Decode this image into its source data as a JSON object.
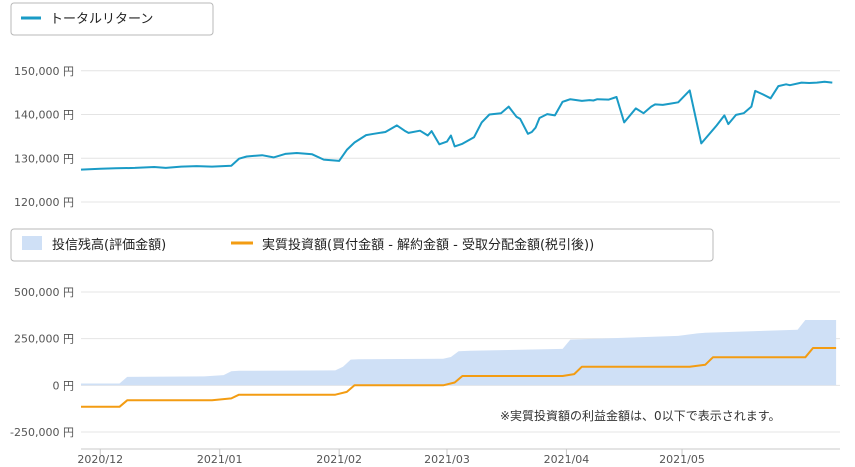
{
  "chart_data": [
    {
      "type": "line",
      "legend": [
        {
          "label": "トータルリターン",
          "color": "#1a9bc6"
        }
      ],
      "yticks": [
        {
          "value": 150000,
          "label": "150,000 円"
        },
        {
          "value": 140000,
          "label": "140,000 円"
        },
        {
          "value": 130000,
          "label": "130,000 円"
        },
        {
          "value": 120000,
          "label": "120,000 円"
        }
      ],
      "ylim": [
        120000,
        152000
      ],
      "series": [
        {
          "name": "トータルリターン",
          "color": "#1a9bc6",
          "x": [
            "2020-11-26",
            "2020-12-01",
            "2020-12-05",
            "2020-12-10",
            "2020-12-15",
            "2020-12-18",
            "2020-12-22",
            "2020-12-26",
            "2020-12-30",
            "2021-01-04",
            "2021-01-06",
            "2021-01-08",
            "2021-01-12",
            "2021-01-15",
            "2021-01-18",
            "2021-01-21",
            "2021-01-25",
            "2021-01-28",
            "2021-02-01",
            "2021-02-03",
            "2021-02-05",
            "2021-02-08",
            "2021-02-10",
            "2021-02-13",
            "2021-02-16",
            "2021-02-18",
            "2021-02-19",
            "2021-02-22",
            "2021-02-24",
            "2021-02-25",
            "2021-02-27",
            "2021-03-01",
            "2021-03-02",
            "2021-03-03",
            "2021-03-05",
            "2021-03-08",
            "2021-03-10",
            "2021-03-12",
            "2021-03-15",
            "2021-03-17",
            "2021-03-19",
            "2021-03-20",
            "2021-03-22",
            "2021-03-23",
            "2021-03-24",
            "2021-03-25",
            "2021-03-27",
            "2021-03-29",
            "2021-03-31",
            "2021-04-01",
            "2021-04-02",
            "2021-04-05",
            "2021-04-07",
            "2021-04-08",
            "2021-04-09",
            "2021-04-12",
            "2021-04-14",
            "2021-04-16",
            "2021-04-19",
            "2021-04-21",
            "2021-04-23",
            "2021-04-24",
            "2021-04-26",
            "2021-04-28",
            "2021-04-30",
            "2021-05-03",
            "2021-05-06",
            "2021-05-10",
            "2021-05-12",
            "2021-05-13",
            "2021-05-15",
            "2021-05-17",
            "2021-05-19",
            "2021-05-20",
            "2021-05-22",
            "2021-05-24",
            "2021-05-26",
            "2021-05-28",
            "2021-05-29",
            "2021-06-01",
            "2021-06-03",
            "2021-06-05",
            "2021-06-07",
            "2021-06-09"
          ],
          "y": [
            127400,
            127600,
            127700,
            127800,
            128000,
            127800,
            128100,
            128200,
            128100,
            128300,
            129900,
            130400,
            130700,
            130200,
            131000,
            131200,
            130900,
            129700,
            129400,
            131900,
            133600,
            135300,
            135600,
            136000,
            137500,
            136300,
            135800,
            136300,
            135200,
            136200,
            133200,
            133800,
            135200,
            132700,
            133300,
            134800,
            138200,
            140000,
            140300,
            141800,
            139500,
            139000,
            135600,
            136000,
            137000,
            139200,
            140100,
            139800,
            142900,
            143200,
            143500,
            143100,
            143300,
            143200,
            143500,
            143400,
            144000,
            138200,
            141400,
            140300,
            141800,
            142300,
            142200,
            142500,
            142800,
            145500,
            133400,
            137500,
            139800,
            137800,
            139900,
            140300,
            141800,
            145400,
            144600,
            143700,
            146500,
            146900,
            146700,
            147300,
            147200,
            147300,
            147500,
            147300
          ]
        }
      ]
    },
    {
      "type": "area",
      "legend": [
        {
          "label": "投信残高(評価金額)",
          "color": "#cfe0f6"
        },
        {
          "label": "実質投資額(買付金額 - 解約金額 - 受取分配金額(税引後))",
          "color": "#f39c12"
        }
      ],
      "yticks": [
        {
          "value": 500000,
          "label": "500,000 円"
        },
        {
          "value": 250000,
          "label": "250,000 円"
        },
        {
          "value": 0,
          "label": "0 円"
        },
        {
          "value": -250000,
          "label": "-250,000 円"
        }
      ],
      "ylim": [
        -250000,
        500000
      ],
      "xticks": [
        {
          "date": "2020-12-01",
          "label": "2020/12"
        },
        {
          "date": "2021-01-01",
          "label": "2021/01"
        },
        {
          "date": "2021-02-01",
          "label": "2021/02"
        },
        {
          "date": "2021-03-01",
          "label": "2021/03"
        },
        {
          "date": "2021-04-01",
          "label": "2021/04"
        },
        {
          "date": "2021-05-01",
          "label": "2021/05"
        }
      ],
      "xlim": [
        "2020-11-26",
        "2021-06-11"
      ],
      "series": [
        {
          "name": "投信残高(評価金額)",
          "color": "#cfe0f6",
          "x": [
            "2020-11-26",
            "2020-12-06",
            "2020-12-08",
            "2020-12-28",
            "2021-01-02",
            "2021-01-04",
            "2021-01-06",
            "2021-01-31",
            "2021-02-02",
            "2021-02-04",
            "2021-02-06",
            "2021-02-28",
            "2021-03-02",
            "2021-03-04",
            "2021-03-07",
            "2021-03-31",
            "2021-04-02",
            "2021-04-30",
            "2021-05-05",
            "2021-05-07",
            "2021-05-31",
            "2021-06-02",
            "2021-06-10"
          ],
          "y": [
            10000,
            10000,
            45000,
            48000,
            55000,
            75000,
            78000,
            80000,
            100000,
            138000,
            140000,
            142000,
            152000,
            183000,
            185000,
            195000,
            245000,
            265000,
            278000,
            282000,
            298000,
            350000,
            350000
          ]
        },
        {
          "name": "実質投資額(買付金額 - 解約金額 - 受取分配金額(税引後))",
          "color": "#f39c12",
          "x": [
            "2020-11-26",
            "2020-12-06",
            "2020-12-08",
            "2020-12-30",
            "2021-01-04",
            "2021-01-06",
            "2021-01-31",
            "2021-02-03",
            "2021-02-05",
            "2021-02-28",
            "2021-03-03",
            "2021-03-05",
            "2021-03-31",
            "2021-04-03",
            "2021-04-05",
            "2021-05-03",
            "2021-05-07",
            "2021-05-09",
            "2021-06-02",
            "2021-06-04",
            "2021-06-10"
          ],
          "y": [
            -115000,
            -115000,
            -80000,
            -80000,
            -70000,
            -50000,
            -50000,
            -35000,
            0,
            0,
            15000,
            50000,
            50000,
            60000,
            100000,
            100000,
            110000,
            150000,
            150000,
            200000,
            200000
          ]
        }
      ]
    }
  ],
  "note": "※実質投資額の利益金額は、0以下で表示されます。"
}
